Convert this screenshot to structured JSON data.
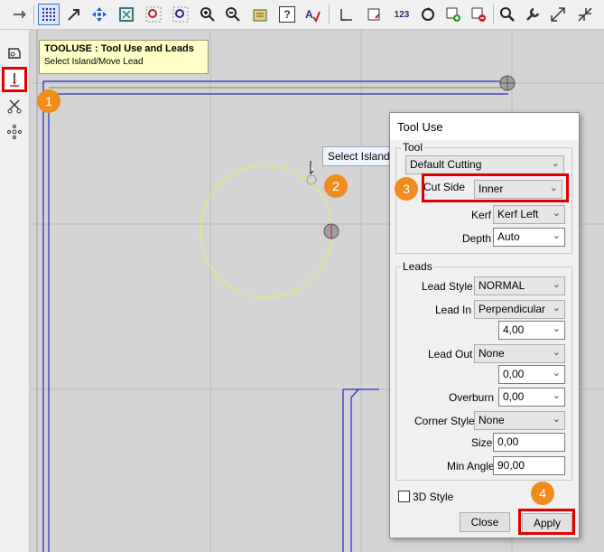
{
  "toolbar": {
    "icons": [
      "pin-icon",
      "grid-icon",
      "arrow-icon",
      "move-icon",
      "fit-icon",
      "zoom-box-icon",
      "zoom-window-icon",
      "zoom-in-icon",
      "zoom-out-icon",
      "toolpath-icon",
      "help-icon",
      "spell-icon",
      "new-part-icon",
      "new-doc-icon",
      "number-icon",
      "rotate-icon",
      "add-icon",
      "remove-icon",
      "search-icon",
      "wrench-icon",
      "expand-icon",
      "collapse-icon"
    ],
    "number_label": "123",
    "help_label": "?"
  },
  "tooltip": {
    "title": "TOOLUSE : Tool Use and Leads",
    "subtitle": "Select Island/Move Lead"
  },
  "hint": {
    "text": "Select Island"
  },
  "badges": [
    "1",
    "2",
    "3",
    "4"
  ],
  "dialog": {
    "title": "Tool Use",
    "tool_group": {
      "label": "Tool",
      "tool_select": "Default Cutting",
      "cut_side_label": "Cut Side",
      "cut_side_value": "Inner",
      "kerf_label": "Kerf",
      "kerf_value": "Kerf Left",
      "depth_label": "Depth",
      "depth_value": "Auto"
    },
    "leads_group": {
      "label": "Leads",
      "lead_style_label": "Lead Style",
      "lead_style_value": "NORMAL",
      "lead_in_label": "Lead In",
      "lead_in_value": "Perpendicular",
      "lead_in_length": "4,00",
      "lead_out_label": "Lead Out",
      "lead_out_value": "None",
      "lead_out_length": "0,00",
      "overburn_label": "Overburn",
      "overburn_value": "0,00",
      "corner_style_label": "Corner Style",
      "corner_style_value": "None",
      "size_label": "Size",
      "size_value": "0,00",
      "min_angle_label": "Min Angle",
      "min_angle_value": "90,00"
    },
    "style_3d_label": "3D Style",
    "close_label": "Close",
    "apply_label": "Apply"
  },
  "colors": {
    "highlight_red": "#e00000",
    "badge_orange": "#f08c1e",
    "contour_blue": "#0000d0",
    "circle_yellow": "#ffff00"
  }
}
